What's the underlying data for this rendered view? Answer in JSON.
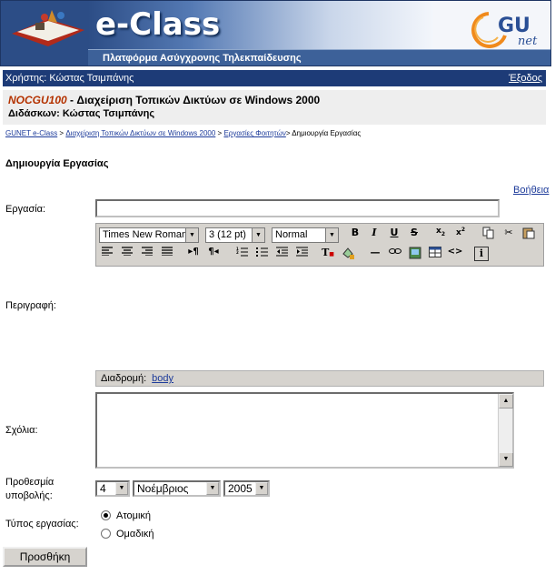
{
  "header": {
    "logo_text": "e-Class",
    "subtitle": "Πλατφόρμα Ασύγχρονης Τηλεκπαίδευσης",
    "gunet_logo": "GU net"
  },
  "userbar": {
    "user_text": "Χρήστης: Κώστας Τσιμπάνης",
    "logout": "Έξοδος"
  },
  "course": {
    "code": "NOCGU100",
    "title": " - Διαχείριση Τοπικών Δικτύων σε Windows 2000",
    "instructor": "Διδάσκων: Κώστας Τσιμπάνης"
  },
  "breadcrumb": {
    "items": [
      "GUNET e-Class",
      "Διαχείριση Τοπικών Δικτύων σε Windows 2000",
      "Εργασίες Φοιτητών"
    ],
    "current": "Δημιουργία Εργασίας"
  },
  "page_title": "Δημιουργία Εργασίας",
  "help_link": "Βοήθεια",
  "form": {
    "title_label": "Εργασία:",
    "title_value": "",
    "description_label": "Περιγραφή:",
    "comments_label": "Σχόλια:",
    "deadline_label_1": "Προθεσμία",
    "deadline_label_2": "υποβολής:",
    "type_label": "Τύπος εργασίας:",
    "type_options": [
      "Ατομική",
      "Ομαδική"
    ],
    "type_selected": "Ατομική",
    "submit_label": "Προσθήκη"
  },
  "editor": {
    "font": "Times New Roman",
    "size": "3 (12 pt)",
    "format": "Normal",
    "path_label": "Διαδρομή:",
    "path_value": "body"
  },
  "deadline": {
    "day": "4",
    "month": "Νοέμβριος",
    "year": "2005"
  }
}
